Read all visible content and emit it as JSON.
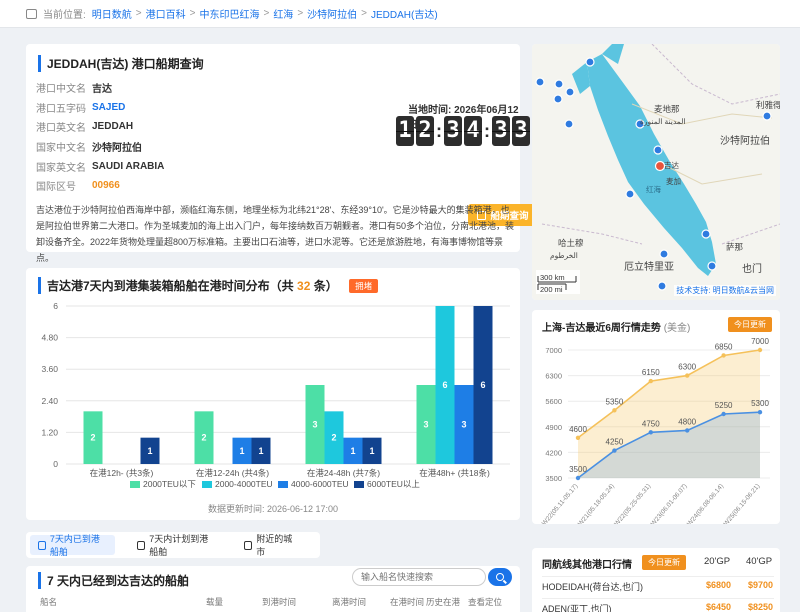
{
  "breadcrumb": {
    "prefix": "当前位置:",
    "items": [
      "明日数航",
      "港口百科",
      "中东印巴红海",
      "红海",
      "沙特阿拉伯",
      "JEDDAH(吉达)"
    ]
  },
  "info": {
    "title": "JEDDAH(吉达) 港口船期查询",
    "fields": [
      {
        "k": "港口中文名",
        "v": "吉达"
      },
      {
        "k": "港口五字码",
        "v": "SAJED"
      },
      {
        "k": "港口英文名",
        "v": "JEDDAH"
      },
      {
        "k": "国家中文名",
        "v": "沙特阿拉伯"
      },
      {
        "k": "国家英文名",
        "v": "SAUDI ARABIA"
      },
      {
        "k": "国际区号",
        "v": "00966"
      }
    ],
    "time_label": "当地时间: 2026年06月12日",
    "clock": [
      "1",
      "2",
      "3",
      "4",
      "3",
      "3"
    ],
    "schedule_button": "船期查询",
    "description": "吉达港位于沙特阿拉伯西海岸中部，濒临红海东侧，地理坐标为北纬21°28'、东经39°10'。它是沙特最大的集装箱港，也是阿拉伯世界第二大港口。作为圣城麦加的海上出入门户，每年接纳数百万朝觐者。港口有50多个泊位，分南北港池，装卸设备齐全。2022年货物处理量超800万标准箱。主要出口石油等，进口水泥等。它还是旅游胜地，有海事博物馆等景点。"
  },
  "map": {
    "labels": [
      "麦地那",
      "المدينة المنورة",
      "利雅得",
      "沙特阿拉伯",
      "吉达",
      "麦加",
      "红海",
      "哈土穆",
      "الخرطوم",
      "厄立特里亚",
      "萨那",
      "也门"
    ],
    "scale": [
      "300 km",
      "200 mi"
    ],
    "credit": "技术支持: 明日数航&云当网",
    "colors": {
      "sea": "#5bc4e0",
      "land": "#f4f4ef",
      "marker": "#2f7be0",
      "current": "#e8543c"
    }
  },
  "distribution": {
    "title_prefix": "吉达港7天内到港集装箱船舶在港时间分布（共",
    "count": "32",
    "title_suffix": "条）",
    "badge": "拥堵",
    "footer": "数据更新时间: 2026-06-12 17:00"
  },
  "trend": {
    "title": "上海-吉达最近6周行情走势",
    "unit": "(美金)",
    "badge": "今日更新"
  },
  "tabs": [
    {
      "label": "7天内已到港船舶",
      "active": true
    },
    {
      "label": "7天内计划到港船舶",
      "active": false
    },
    {
      "label": "附近的城市",
      "active": false
    }
  ],
  "arrived": {
    "title": "7 天内已经到达吉达的船舶",
    "search_placeholder": "输入船名快速搜索",
    "columns": [
      "船名",
      "载量",
      "到港时间",
      "离港时间",
      "在港时间",
      "历史在港",
      "查看定位"
    ]
  },
  "rates": {
    "title": "同航线其他港口行情",
    "badge": "今日更新",
    "col_20": "20'GP",
    "col_40": "40'GP",
    "rows": [
      {
        "port": "HODEIDAH(荷台达,也门)",
        "p20": "$6800",
        "p40": "$9700"
      },
      {
        "port": "ADEN(亚丁,也门)",
        "p20": "$6450",
        "p40": "$8250"
      }
    ]
  },
  "chart_data": [
    {
      "type": "bar",
      "title": "吉达港7天内到港集装箱船舶在港时间分布（共32条）",
      "categories": [
        "在港12h- (共3条)",
        "在港12-24h (共4条)",
        "在港24-48h (共7条)",
        "在港48h+ (共18条)"
      ],
      "series": [
        {
          "name": "2000TEU以下",
          "values": [
            2,
            2,
            3,
            3
          ],
          "color": "#4ddfa6"
        },
        {
          "name": "2000-4000TEU",
          "values": [
            0,
            0,
            2,
            6
          ],
          "color": "#1ec8dd"
        },
        {
          "name": "4000-6000TEU",
          "values": [
            0,
            1,
            1,
            3
          ],
          "color": "#1e7ee6"
        },
        {
          "name": "6000TEU以上",
          "values": [
            1,
            1,
            1,
            6
          ],
          "color": "#12438f"
        }
      ],
      "yticks": [
        "0",
        "1.20",
        "2.40",
        "3.60",
        "4.80",
        "6"
      ],
      "ylim": [
        0,
        6
      ],
      "grid": true,
      "legend": "bottom"
    },
    {
      "type": "line",
      "title": "上海-吉达最近6周行情走势",
      "x": [
        "W22(05.11-05.17)",
        "W21(05.18-05.24)",
        "W22(05.25-05.31)",
        "W23(06.01-06.07)",
        "W24(06.08-06.14)",
        "W25(06.15-06.21)"
      ],
      "series": [
        {
          "name": "40'GP",
          "values": [
            4600,
            5350,
            6150,
            6300,
            6850,
            7000
          ],
          "color": "#f5c15a"
        },
        {
          "name": "20'GP",
          "values": [
            3500,
            4250,
            4750,
            4800,
            5250,
            5300
          ],
          "color": "#4a90e2"
        }
      ],
      "yticks": [
        "3500",
        "4200",
        "4900",
        "5600",
        "6300",
        "7000"
      ],
      "ylim": [
        3500,
        7000
      ],
      "grid": true
    }
  ]
}
